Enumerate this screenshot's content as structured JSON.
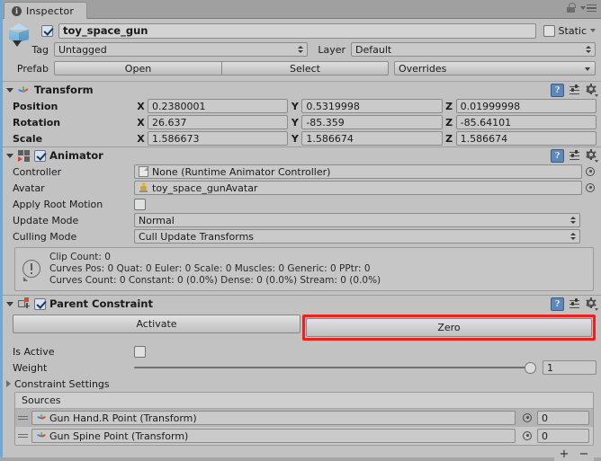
{
  "window": {
    "tab_label": "Inspector",
    "tab_icon": "info-icon",
    "lock_icon": "lock-icon",
    "menu_icon": "hamburger-menu-icon"
  },
  "gameobject": {
    "icon": "prefab-cube-icon",
    "enabled": true,
    "name": "toy_space_gun",
    "static_label": "Static",
    "static_checked": false,
    "tag_label": "Tag",
    "tag_value": "Untagged",
    "layer_label": "Layer",
    "layer_value": "Default",
    "prefab_label": "Prefab",
    "prefab_open": "Open",
    "prefab_select": "Select",
    "prefab_overrides": "Overrides"
  },
  "transform": {
    "title": "Transform",
    "icon": "transform-axis-icon",
    "rows": [
      {
        "label": "Position",
        "x_label": "X",
        "x": "0.2380001",
        "y_label": "Y",
        "y": "0.5319998",
        "z_label": "Z",
        "z": "0.01999998"
      },
      {
        "label": "Rotation",
        "x_label": "X",
        "x": "26.637",
        "y_label": "Y",
        "y": "-85.359",
        "z_label": "Z",
        "z": "-85.64101"
      },
      {
        "label": "Scale",
        "x_label": "X",
        "x": "1.586673",
        "y_label": "Y",
        "y": "1.586674",
        "z_label": "Z",
        "z": "1.586674"
      }
    ]
  },
  "animator": {
    "title": "Animator",
    "icon": "animator-icon",
    "enabled": true,
    "controller_label": "Controller",
    "controller_value": "None (Runtime Animator Controller)",
    "avatar_label": "Avatar",
    "avatar_value": "toy_space_gunAvatar",
    "apply_root_motion_label": "Apply Root Motion",
    "apply_root_motion_checked": false,
    "update_mode_label": "Update Mode",
    "update_mode_value": "Normal",
    "culling_mode_label": "Culling Mode",
    "culling_mode_value": "Cull Update Transforms",
    "info": {
      "icon": "warning-info-icon",
      "line1": "Clip Count: 0",
      "line2": "Curves Pos: 0 Quat: 0 Euler: 0 Scale: 0 Muscles: 0 Generic: 0 PPtr: 0",
      "line3": "Curves Count: 0 Constant: 0 (0.0%) Dense: 0 (0.0%) Stream: 0 (0.0%)"
    }
  },
  "parent_constraint": {
    "title": "Parent Constraint",
    "icon": "parent-constraint-icon",
    "enabled": true,
    "activate_button": "Activate",
    "zero_button": "Zero",
    "zero_highlight_color": "#ef2020",
    "is_active_label": "Is Active",
    "is_active_checked": false,
    "weight_label": "Weight",
    "weight_value": "1",
    "constraint_settings_label": "Constraint Settings",
    "sources_label": "Sources",
    "sources": [
      {
        "name": "Gun Hand.R Point (Transform)",
        "weight": "0"
      },
      {
        "name": "Gun Spine Point (Transform)",
        "weight": "0"
      }
    ],
    "add_button": "+",
    "remove_button": "−"
  },
  "component_tools": {
    "help_icon": "help-book-icon",
    "preset_icon": "preset-icon",
    "gear_icon": "gear-icon"
  }
}
